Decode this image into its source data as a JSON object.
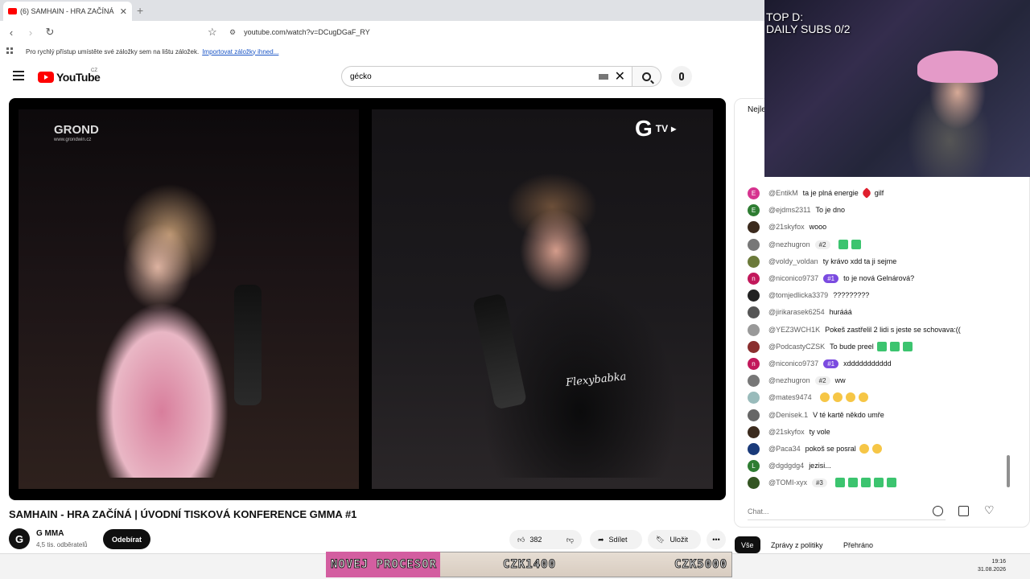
{
  "browser": {
    "tab_title": "(6) SAMHAIN - HRA ZAČÍNÁ",
    "url": "youtube.com/watch?v=DCugDGaF_RY",
    "bookmarks_prompt": "Pro rychlý přístup umístěte své záložky sem na lištu záložek.",
    "bookmarks_link": "Importovat záložky ihned..."
  },
  "masthead": {
    "logo": "YouTube",
    "country": "CZ",
    "search_value": "gécko"
  },
  "video": {
    "title": "SAMHAIN - HRA ZAČÍNÁ | ÚVODNÍ TISKOVÁ KONFERENCE GMMA #1",
    "watermark_left": "GROND",
    "watermark_left_sub": "www.grondwin.cz",
    "watermark_right": "G",
    "watermark_right_sub": "TV",
    "shirt_text": "Flexybabka"
  },
  "channel": {
    "avatar": "G",
    "name": "G MMA",
    "subs": "4,5 tis. odběratelů",
    "subscribe": "Odebírat"
  },
  "actions": {
    "likes": "382",
    "share": "Sdílet",
    "save": "Uložit",
    "more": "•••"
  },
  "chat": {
    "header": "Nejle",
    "input_placeholder": "Chat...",
    "messages": [
      {
        "author": "@EntikM",
        "text": "ta je plná energie",
        "emotes": "heart",
        "suffix": "gilf",
        "avatar": "E",
        "color": "#d6338f"
      },
      {
        "author": "@ejdms2311",
        "text": "To je dno",
        "avatar": "E",
        "color": "#2e7d32"
      },
      {
        "author": "@21skyfox",
        "text": "wooo",
        "avatar": "",
        "color": "#3b2a1d"
      },
      {
        "author": "@nezhugron",
        "badge": "#2",
        "text": "",
        "emotes": "sq2",
        "avatar": "",
        "color": "#777"
      },
      {
        "author": "@voldy_voldan",
        "text": "ty krávo xdd ta ji sejme",
        "avatar": "",
        "color": "#6b7a3a"
      },
      {
        "author": "@niconico9737",
        "badge": "#1",
        "text": "to je nová Gelnárová?",
        "avatar": "n",
        "color": "#c2185b"
      },
      {
        "author": "@tomjedlicka3379",
        "text": "?????????",
        "avatar": "",
        "color": "#222"
      },
      {
        "author": "@jirikarasek6254",
        "text": "hurááá",
        "avatar": "",
        "color": "#555"
      },
      {
        "author": "@YEZ3WCH1K",
        "text": "Pokeš zastřelil 2 lidi s jeste se schovava:((",
        "avatar": "",
        "color": "#999"
      },
      {
        "author": "@PodcastyCZSK",
        "text": "To bude preel",
        "emotes": "sq3",
        "avatar": "",
        "color": "#8a2f2f"
      },
      {
        "author": "@niconico9737",
        "badge": "#1",
        "text": "xddddddddddd",
        "avatar": "n",
        "color": "#c2185b"
      },
      {
        "author": "@nezhugron",
        "badge": "#2",
        "text": "ww",
        "avatar": "",
        "color": "#777"
      },
      {
        "author": "@mates9474",
        "text": "",
        "emotes": "face4",
        "avatar": "",
        "color": "#9bb"
      },
      {
        "author": "@Denisek.1",
        "text": "V té kartě někdo umře",
        "avatar": "",
        "color": "#666"
      },
      {
        "author": "@21skyfox",
        "text": "ty vole",
        "avatar": "",
        "color": "#3b2a1d"
      },
      {
        "author": "@Paca34",
        "text": "pokoš se posral",
        "emotes": "face2",
        "avatar": "",
        "color": "#1a3a7a"
      },
      {
        "author": "@dgdgdg4",
        "text": "jezisi...",
        "avatar": "L",
        "color": "#2e7d32"
      },
      {
        "author": "@TOMI-xyx",
        "badge": "#3",
        "text": "",
        "emotes": "sq5",
        "avatar": "",
        "color": "#335522"
      }
    ],
    "filters": [
      "Vše",
      "Zprávy z politiky",
      "Přehráno"
    ]
  },
  "stream_overlay": {
    "top_line1": "TOP D:",
    "top_line2": "DAILY SUBS 0/2",
    "ticker_left": "NOVEJ PROCESOR",
    "ticker_mid": "CZK1400",
    "ticker_right": "CZK5000"
  },
  "taskbar": {
    "time": "19:16",
    "date": "31.08.2026"
  }
}
